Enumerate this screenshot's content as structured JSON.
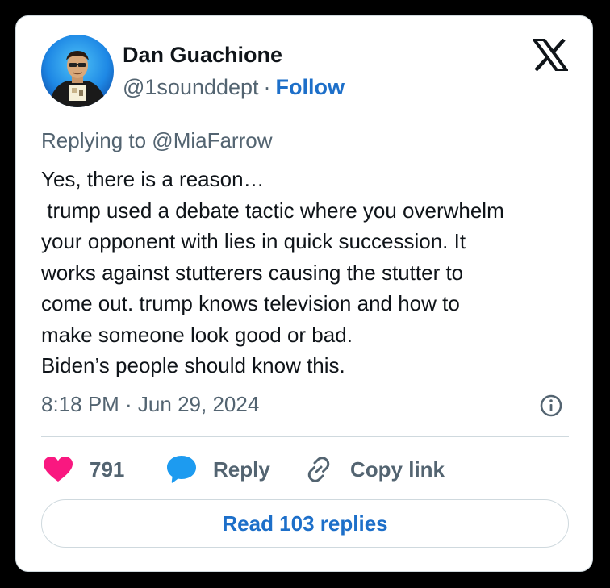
{
  "author": {
    "name": "Dan Guachione",
    "handle": "@1sounddept",
    "separator": "·",
    "follow_label": "Follow"
  },
  "brand": {
    "logo_icon": "x-logo-icon"
  },
  "tweet": {
    "replying_to": "Replying to @MiaFarrow",
    "lines": [
      "Yes, there is a reason…",
      " trump used a debate tactic where you overwhelm",
      "your opponent with lies in quick succession. It",
      "works against stutterers causing the stutter to",
      "come out. trump knows television and how to",
      "make someone look good or bad.",
      "Biden’s people should know this."
    ],
    "timestamp": "8:18 PM · Jun 29, 2024",
    "info_icon": "info-icon"
  },
  "actions": {
    "likes_count": "791",
    "like_icon": "heart-icon",
    "reply_label": "Reply",
    "reply_icon": "speech-bubble-icon",
    "copy_label": "Copy link",
    "copy_icon": "link-icon"
  },
  "footer": {
    "read_replies_label": "Read 103 replies"
  },
  "colors": {
    "accent_blue": "#1d6fc9",
    "heart_pink": "#f91880",
    "bubble_blue": "#1d9bf0",
    "muted_text": "#536471",
    "primary_text": "#0f1419",
    "border": "#cfd9de"
  }
}
